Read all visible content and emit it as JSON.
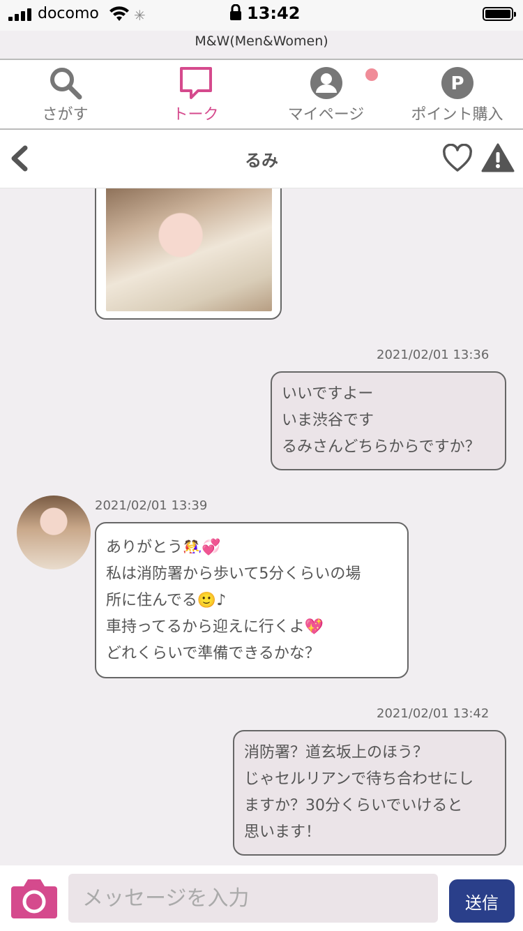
{
  "status_bar": {
    "carrier": "docomo",
    "time": "13:42"
  },
  "site_title": "M&W(Men&Women)",
  "nav": {
    "items": [
      {
        "label": "さがす",
        "icon": "search-icon"
      },
      {
        "label": "トーク",
        "icon": "chat-icon",
        "active": true
      },
      {
        "label": "マイページ",
        "icon": "user-icon"
      },
      {
        "label": "ポイント購入",
        "icon": "points-icon"
      }
    ]
  },
  "header": {
    "title": "るみ"
  },
  "messages": [
    {
      "type": "mine",
      "time": "2021/02/01 13:36",
      "lines": [
        "いいですよー",
        "いま渋谷です",
        "るみさんどちらからですか？"
      ]
    },
    {
      "type": "theirs",
      "time": "2021/02/01 13:39",
      "lines": [
        "ありがとう🤼‍♀️💞",
        "私は消防署から歩いて5分くらいの場",
        "所に住んでる🙂♪",
        "車持ってるから迎えに行くよ💖",
        "どれくらいで準備できるかな？"
      ]
    },
    {
      "type": "mine",
      "time": "2021/02/01 13:42",
      "lines": [
        "消防署？道玄坂上のほう？",
        "じゃセルリアンで待ち合わせにし",
        "ますか？30分くらいでいけると",
        "思います！"
      ]
    }
  ],
  "composer": {
    "placeholder": "メッセージを入力",
    "send_label": "送信"
  },
  "colors": {
    "accent": "#d54a8d",
    "send": "#2a3f8a",
    "badge": "#f08c98"
  }
}
